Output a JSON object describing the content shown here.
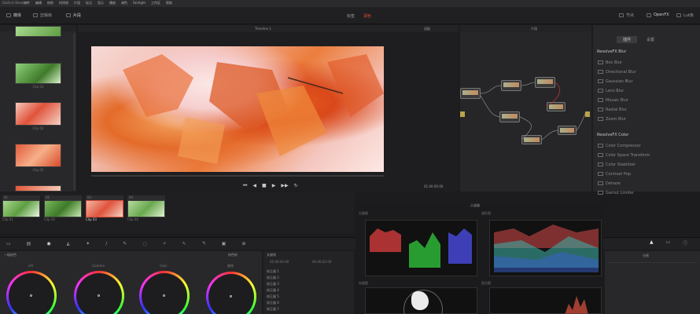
{
  "window": {
    "title": "DaVinci Resolve",
    "menu": [
      "文件",
      "编辑",
      "修剪",
      "时间线",
      "片段",
      "标记",
      "显示",
      "播放",
      "调色",
      "Fairlight",
      "工作区",
      "帮助"
    ],
    "menu_icons": [
      "square",
      "square",
      "square",
      "square",
      "square",
      "square",
      "square",
      "square",
      "square",
      "square",
      "square"
    ]
  },
  "toolbar": {
    "left_buttons": [
      "媒体",
      "剪辑库"
    ],
    "center_a": "标签",
    "center_b": "调色",
    "right_buttons": [
      "节点",
      "OpenFX",
      "Lut库"
    ]
  },
  "viewer": {
    "timeline_label": "Timeline 1",
    "clip_label": "片段",
    "zoom_label": "适配",
    "timecode": "01:00:00:00",
    "playback_icons": [
      "skip-back",
      "step-back",
      "stop",
      "play",
      "step-forward",
      "loop"
    ]
  },
  "node_editor": {
    "label": "片段",
    "node_labels": [
      "01",
      "02",
      "03",
      "04",
      "05",
      "06",
      "07",
      "08"
    ]
  },
  "openfx": {
    "tabs": [
      "插件",
      "设置"
    ],
    "sections": [
      {
        "title": "ResolveFX Blur",
        "items": [
          "Box Blur",
          "Directional Blur",
          "Gaussian Blur",
          "Lens Blur",
          "Mosaic Blur",
          "Radial Blur",
          "Zoom Blur"
        ]
      },
      {
        "title": "ResolveFX Color",
        "items": [
          "Color Compressor",
          "Color Space Transform",
          "Color Stabilizer",
          "Contrast Pop",
          "Dehaze",
          "Gamut Limiter"
        ]
      }
    ]
  },
  "media_bin": {
    "clips": [
      {
        "label": "Clip 01",
        "colors": [
          "#6aa84f",
          "#d9ead3"
        ]
      },
      {
        "label": "Clip 02",
        "colors": [
          "#e06666",
          "#f4cccc"
        ]
      },
      {
        "label": "Clip 03",
        "colors": [
          "#e06666",
          "#fce5cd"
        ]
      },
      {
        "label": "Clip 04",
        "colors": [
          "#e06666",
          "#f4cccc"
        ]
      }
    ]
  },
  "timeline_thumbs": {
    "clips": [
      {
        "id": "01",
        "label": "Clip 01"
      },
      {
        "id": "02",
        "label": "Clip 02"
      },
      {
        "id": "03",
        "label": "Clip 03"
      },
      {
        "id": "04",
        "label": "Clip 04"
      }
    ]
  },
  "color_wheels": {
    "title": "一级校色",
    "mode": "校色轮",
    "wheels": [
      "Lift",
      "Gamma",
      "Gain",
      "偏移"
    ],
    "wheel_values": [
      "0.00",
      "0.00",
      "0.00",
      "0.00"
    ]
  },
  "key_panel": {
    "title": "关键帧",
    "columns": [
      "00:00:00:00",
      "00:00:02:00"
    ],
    "rows": [
      "校正器 1",
      "校正器 2",
      "校正器 3",
      "校正器 4",
      "校正器 5",
      "校正器 6",
      "校正器 7"
    ]
  },
  "scopes": {
    "title": "示波器",
    "panes": [
      "分量图",
      "波形图",
      "矢量图",
      "直方图"
    ]
  },
  "right_tools": {
    "label": "分割"
  }
}
